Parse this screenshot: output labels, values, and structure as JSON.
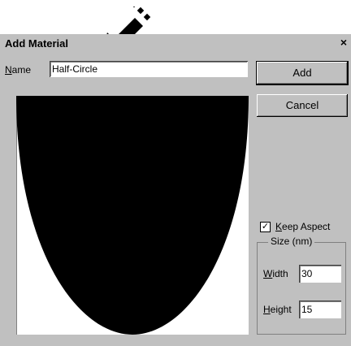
{
  "window": {
    "title": "Add Material"
  },
  "name_field": {
    "label_u": "N",
    "label_rest": "ame",
    "value": "Half-Circle"
  },
  "buttons": {
    "add": "Add",
    "cancel": "Cancel"
  },
  "keep_aspect": {
    "label_u": "K",
    "label_rest": "eep Aspect",
    "checked": true
  },
  "size_group": {
    "label": "Size (nm)",
    "width": {
      "label_u": "W",
      "label_rest": "idth",
      "value": "30"
    },
    "height": {
      "label_u": "H",
      "label_rest": "eight",
      "value": "15"
    }
  },
  "icons": {
    "close": "close-icon",
    "arrow": "pointer-arrow-icon"
  }
}
